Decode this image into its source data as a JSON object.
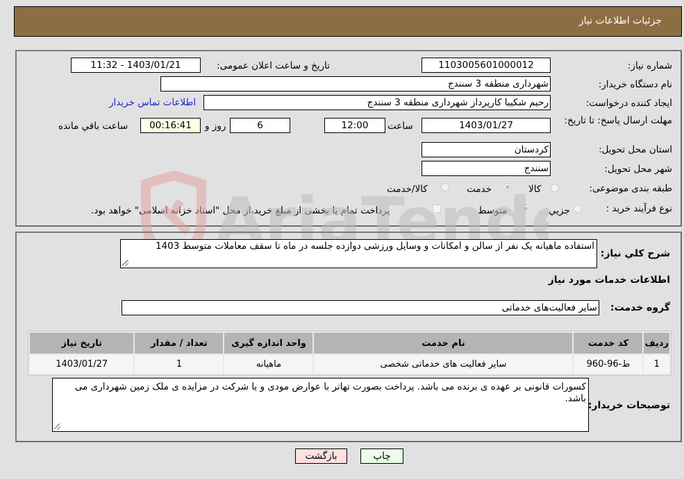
{
  "header": {
    "title": "جزئیات اطلاعات نیاز"
  },
  "fields": {
    "need_number": {
      "label": "شماره نیاز:",
      "value": "1103005601000012"
    },
    "announce_datetime": {
      "label": "تاریخ و ساعت اعلان عمومی:",
      "value": "1403/01/21 - 11:32"
    },
    "buyer_org": {
      "label": "نام دستگاه خریدار:",
      "value": "شهرداری منطقه 3 سنندج"
    },
    "requester": {
      "label": "ایجاد کننده درخواست:",
      "value": "رحیم شکیبا کارپرداز شهرداری منطقه 3 سنندج"
    },
    "buyer_contact_link": "اطلاعات تماس خریدار",
    "deadline": {
      "label": "مهلت ارسال پاسخ: تا تاریخ:",
      "date": "1403/01/27",
      "time_label": "ساعت",
      "time": "12:00",
      "days": "6",
      "days_label": "روز و",
      "remaining": "00:16:41",
      "remaining_label": "ساعت باقي مانده"
    },
    "province": {
      "label": "استان محل تحویل:",
      "value": "کردستان"
    },
    "city": {
      "label": "شهر محل تحویل:",
      "value": "سنندج"
    },
    "category": {
      "label": "طبقه بندی موضوعی:",
      "options": [
        {
          "label": "کالا",
          "checked": false
        },
        {
          "label": "خدمت",
          "checked": true
        },
        {
          "label": "کالا/خدمت",
          "checked": false
        }
      ]
    },
    "process_type": {
      "label": "نوع فرآیند خرید :",
      "options": [
        {
          "label": "جزيي",
          "checked": false
        },
        {
          "label": "متوسط",
          "checked": true
        }
      ],
      "treasury_checkbox_label": "پرداخت تمام یا بخشی از مبلغ خرید،از محل \"اسناد خزانه اسلامی\" خواهد بود.",
      "treasury_checked": false
    }
  },
  "description": {
    "label": "شرح كلي نياز:",
    "value": "استفاده ماهیانه یک نفر  از سالن و امکانات و وسایل ورزشی دوازده جلسه در ماه تا سقف معاملات متوسط 1403"
  },
  "services_section": {
    "title": "اطلاعات خدمات مورد نیاز",
    "group_label": "گروه خدمت:",
    "group_value": "سایر فعالیت‌های خدماتی",
    "table": {
      "columns": [
        "ردیف",
        "کد خدمت",
        "نام خدمت",
        "واحد اندازه گیری",
        "تعداد / مقدار",
        "تاریخ نیاز"
      ],
      "rows": [
        [
          "1",
          "ط-96-960",
          "سایر فعالیت های خدماتی شخصی",
          "ماهیانه",
          "1",
          "1403/01/27"
        ]
      ]
    }
  },
  "buyer_notes": {
    "label": "توضیحات خریدار:",
    "value": "کسورات قانونی بر عهده ی برنده می باشد. پرداخت بصورت تهاتر با عوارض مودی و یا شرکت در مزایده ی ملک  زمین شهرداری می باشد."
  },
  "buttons": {
    "print": "چاپ",
    "back": "بازگشت"
  },
  "colors": {
    "header_bg": "#8d6e43",
    "print_bg": "#eaffea",
    "back_bg": "#ffe0e0",
    "remaining_bg": "#ffffe8",
    "link": "#2222cc"
  },
  "watermark": {
    "text": "AriaTender.neT"
  }
}
